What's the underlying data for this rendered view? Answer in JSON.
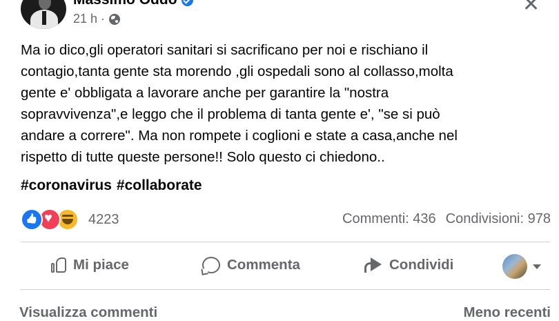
{
  "post": {
    "author": "Massimo Oddo",
    "time": "21 h ·",
    "lines": [
      "Ma io dico,gli operatori sanitari si sacrificano per noi e rischiano il",
      "contagio,tanta gente sta morendo ,gli ospedali sono al collasso,molta",
      "gente e' obbligata a lavorare anche per garantire la \"nostra",
      "sopravvivenza\",e leggo che il problema di tanta gente e', \"se si può",
      "andare a correre\". Ma non rompete i coglioni e state a casa,anche nel",
      "rispetto di tutte queste persone!! Solo questo ci chiedono.."
    ],
    "hashtags": [
      "#coronavirus",
      "#collaborate"
    ]
  },
  "stats": {
    "reactions": "4223",
    "comments": "Commenti: 436",
    "shares": "Condivisioni: 978"
  },
  "actions": {
    "like": "Mi piace",
    "comment": "Commenta",
    "share": "Condividi"
  },
  "footer": {
    "view_comments": "Visualizza commenti",
    "sort": "Meno recenti"
  },
  "colors": {
    "accent": "#1877f2",
    "love": "#f33e58",
    "haha": "#f7b928",
    "muted": "#65676b"
  }
}
